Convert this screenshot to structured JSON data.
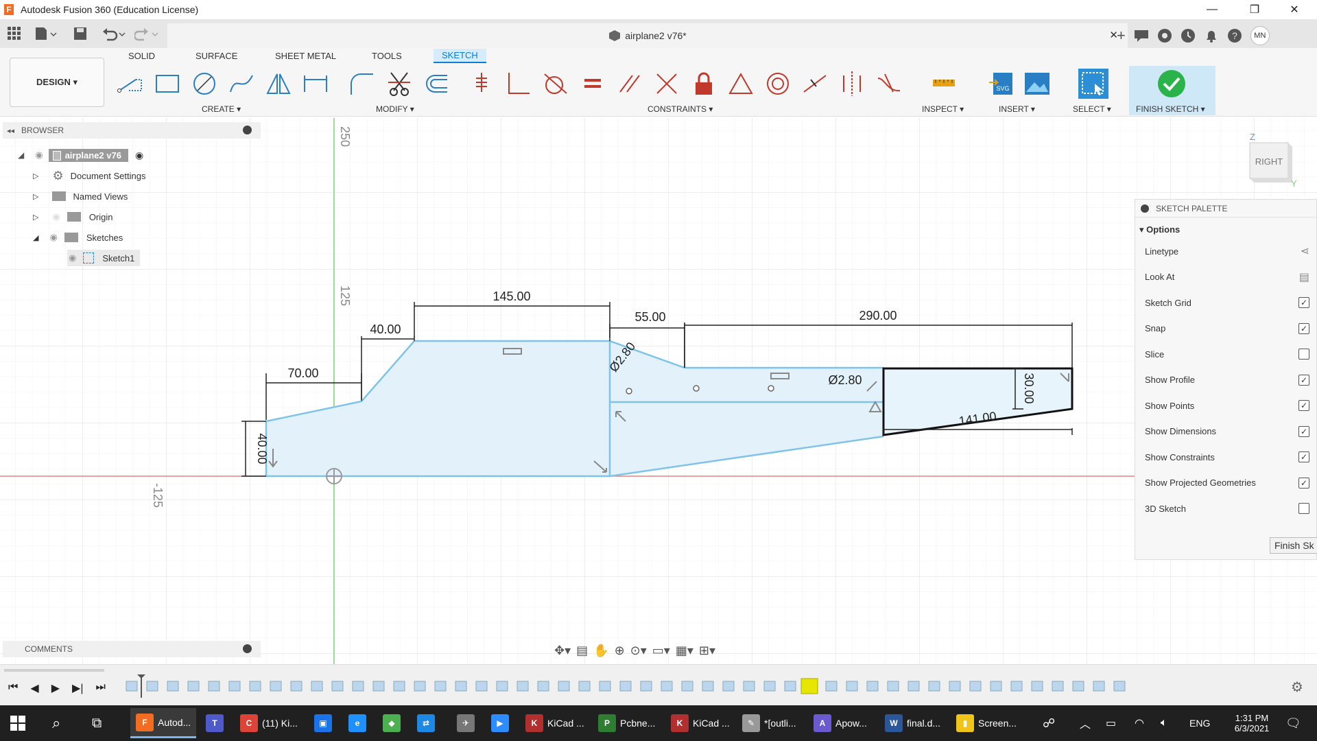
{
  "window": {
    "title": "Autodesk Fusion 360 (Education License)",
    "minimize": "—",
    "maximize": "❐",
    "close": "✕"
  },
  "document": {
    "tab_title": "airplane2 v76*",
    "tab_close": "✕",
    "user_initials": "MN"
  },
  "ribbon": {
    "design_label": "DESIGN ▾",
    "tabs": [
      "SOLID",
      "SURFACE",
      "SHEET METAL",
      "TOOLS",
      "SKETCH"
    ],
    "active_tab": "SKETCH",
    "groups": {
      "create": "CREATE ▾",
      "modify": "MODIFY ▾",
      "constraints": "CONSTRAINTS ▾",
      "inspect": "INSPECT ▾",
      "insert": "INSERT ▾",
      "select": "SELECT ▾",
      "finish": "FINISH SKETCH ▾"
    }
  },
  "browser": {
    "header": "BROWSER",
    "root": "airplane2 v76",
    "items": [
      {
        "label": "Document Settings",
        "icon": "gear-icon"
      },
      {
        "label": "Named Views",
        "icon": "folder-icon"
      },
      {
        "label": "Origin",
        "icon": "folder-icon"
      },
      {
        "label": "Sketches",
        "icon": "folder-icon"
      },
      {
        "label": "Sketch1",
        "icon": "sketch-icon"
      }
    ]
  },
  "comments": {
    "header": "COMMENTS"
  },
  "viewcube": {
    "face": "RIGHT",
    "axis_z": "Z",
    "axis_y": "Y"
  },
  "grid_labels": {
    "top": "250",
    "mid": "125",
    "neg": "-125"
  },
  "dimensions": {
    "d145": "145.00",
    "d40a": "40.00",
    "d55": "55.00",
    "d290": "290.00",
    "d70": "70.00",
    "d40v": "40.00",
    "d30": "30.00",
    "d141": "141.00",
    "dia1": "Ø2.80",
    "dia2": "Ø2.80"
  },
  "palette": {
    "header": "SKETCH PALETTE",
    "section": "Options",
    "options": [
      {
        "label": "Linetype",
        "checked": null
      },
      {
        "label": "Look At",
        "checked": null
      },
      {
        "label": "Sketch Grid",
        "checked": true
      },
      {
        "label": "Snap",
        "checked": true
      },
      {
        "label": "Slice",
        "checked": false
      },
      {
        "label": "Show Profile",
        "checked": true
      },
      {
        "label": "Show Points",
        "checked": true
      },
      {
        "label": "Show Dimensions",
        "checked": true
      },
      {
        "label": "Show Constraints",
        "checked": true
      },
      {
        "label": "Show Projected Geometries",
        "checked": true
      },
      {
        "label": "3D Sketch",
        "checked": false
      }
    ],
    "finish_button": "Finish Sk"
  },
  "taskbar": {
    "items": [
      {
        "label": "Autod...",
        "icon_text": "F",
        "color": "#f26c22"
      },
      {
        "label": "",
        "icon_text": "T",
        "color": "#5059c9"
      },
      {
        "label": "(11) Ki...",
        "icon_text": "C",
        "color": "#db4437"
      },
      {
        "label": "",
        "icon_text": "▣",
        "color": "#1a73e8"
      },
      {
        "label": "",
        "icon_text": "e",
        "color": "#1e90ff"
      },
      {
        "label": "",
        "icon_text": "◆",
        "color": "#4caf50"
      },
      {
        "label": "",
        "icon_text": "⇄",
        "color": "#1e88e5"
      },
      {
        "label": "",
        "icon_text": "✈",
        "color": "#777777"
      },
      {
        "label": "",
        "icon_text": "▶",
        "color": "#2d8cff"
      },
      {
        "label": "KiCad ...",
        "icon_text": "K",
        "color": "#b03030"
      },
      {
        "label": "Pcbne...",
        "icon_text": "P",
        "color": "#2e7d32"
      },
      {
        "label": "KiCad ...",
        "icon_text": "K",
        "color": "#b03030"
      },
      {
        "label": "*[outli...",
        "icon_text": "✎",
        "color": "#999999"
      },
      {
        "label": "Apow...",
        "icon_text": "A",
        "color": "#6a5acd"
      },
      {
        "label": "final.d...",
        "icon_text": "W",
        "color": "#2b579a"
      },
      {
        "label": "Screen...",
        "icon_text": "▮",
        "color": "#f0c419"
      }
    ],
    "lang": "ENG",
    "time": "1:31 PM",
    "date": "6/3/2021"
  },
  "colors": {
    "accent": "#0a7dd6",
    "profile_fill": "#e3f1fa",
    "profile_stroke": "#7ec3e8",
    "x_axis": "#e88080",
    "y_axis": "#7ed37e"
  }
}
